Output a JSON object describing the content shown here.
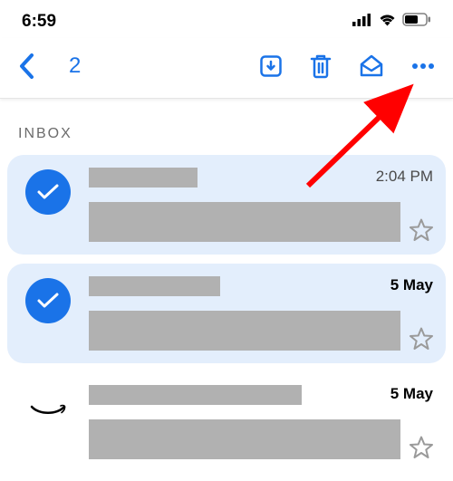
{
  "status": {
    "time": "6:59"
  },
  "toolbar": {
    "selected_count": "2"
  },
  "section": {
    "label": "INBOX"
  },
  "emails": [
    {
      "timestamp": "2:04 PM",
      "timestamp_bold": false,
      "selected": true
    },
    {
      "timestamp": "5 May",
      "timestamp_bold": true,
      "selected": true
    },
    {
      "timestamp": "5 May",
      "timestamp_bold": true,
      "selected": false,
      "sender_icon": "amazon"
    }
  ],
  "colors": {
    "accent": "#1a73e8",
    "selected_bg": "#e3eefc",
    "placeholder": "#b1b1b1",
    "arrow": "#ff0000"
  }
}
